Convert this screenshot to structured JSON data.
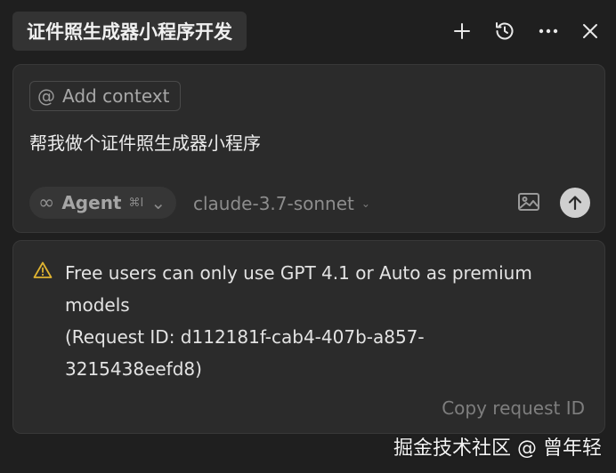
{
  "header": {
    "title": "证件照生成器小程序开发",
    "icons": [
      "plus-icon",
      "history-icon",
      "more-icon",
      "close-icon"
    ]
  },
  "composer": {
    "add_context_label": "Add context",
    "add_context_icon": "@",
    "prompt_text": "帮我做个证件照生成器小程序",
    "mode": {
      "icon": "∞",
      "label": "Agent",
      "shortcut": "⌘I",
      "chevron": "⌄"
    },
    "model": {
      "value": "claude-3.7-sonnet",
      "chevron": "⌄"
    },
    "icons": [
      "image-icon",
      "send-arrow-icon"
    ]
  },
  "error": {
    "lines": [
      "Free users can only use GPT 4.1 or Auto as premium",
      "models",
      "(Request ID: d112181f-cab4-407b-a857-",
      "3215438eefd8)"
    ],
    "copy_label": "Copy request ID",
    "warning_color": "#e0b431"
  },
  "watermark": "掘金技术社区 @ 曾年轻"
}
